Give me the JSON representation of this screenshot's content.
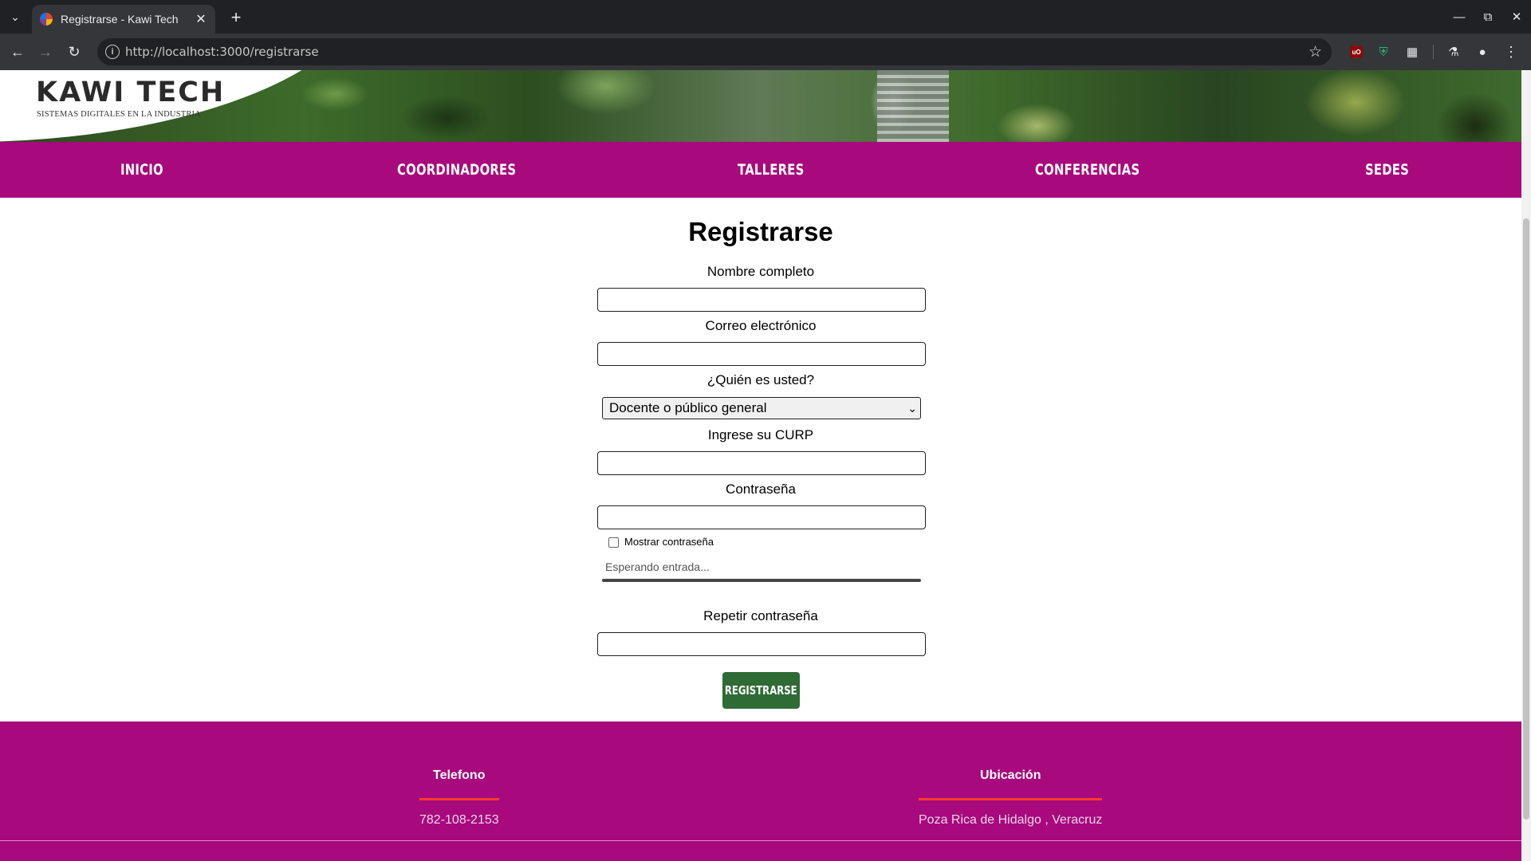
{
  "browser": {
    "tab_title": "Registrarse - Kawi Tech",
    "url": "http://localhost:3000/registrarse"
  },
  "site": {
    "logo_title": "KAWI TECH",
    "logo_subtitle": "SISTEMAS DIGITALES EN LA INDUSTRIA"
  },
  "nav": {
    "items": [
      {
        "label": "INICIO"
      },
      {
        "label": "COORDINADORES"
      },
      {
        "label": "TALLERES"
      },
      {
        "label": "CONFERENCIAS"
      },
      {
        "label": "SEDES"
      }
    ]
  },
  "form": {
    "title": "Registrarse",
    "full_name_label": "Nombre completo",
    "full_name_value": "",
    "email_label": "Correo electrónico",
    "email_value": "",
    "role_label": "¿Quién es usted?",
    "role_selected": "Docente o público general",
    "curp_label": "Ingrese su CURP",
    "curp_value": "",
    "password_label": "Contraseña",
    "password_value": "",
    "show_password_label": "Mostrar contraseña",
    "show_password_checked": false,
    "password_strength_text": "Esperando entrada...",
    "repeat_password_label": "Repetir contraseña",
    "repeat_password_value": "",
    "submit_label": "REGISTRARSE"
  },
  "footer": {
    "phone_heading": "Telefono",
    "phone_value": "782-108-2153",
    "location_heading": "Ubicación",
    "location_value": "Poza Rica de Hidalgo , Veracruz"
  },
  "colors": {
    "brand_magenta": "#a8097c",
    "submit_green": "#2f6b35",
    "footer_accent": "#ff3b2f"
  }
}
